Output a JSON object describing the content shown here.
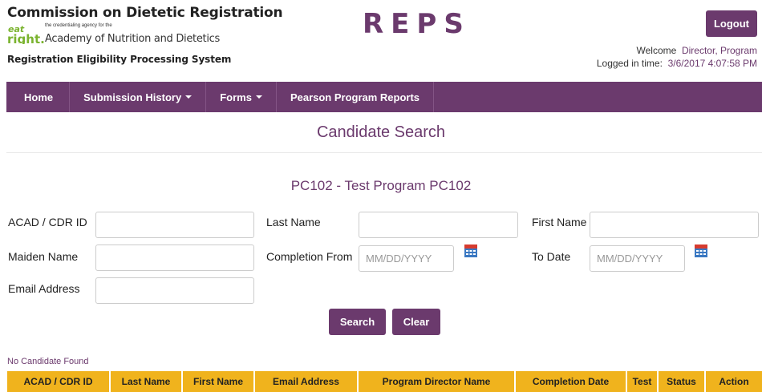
{
  "header": {
    "org_title": "Commission on Dietetic Registration",
    "eatright_logo": "eat right.",
    "tagline": "the credentialing agency for the",
    "academy": "Academy of Nutrition and Dietetics",
    "system_name": "Registration Eligibility Processing System",
    "app_logo": "REPS",
    "logout_label": "Logout",
    "welcome_prefix": "Welcome",
    "user_name": "Director, Program",
    "logged_in_label": "Logged in time:",
    "logged_in_time": "3/6/2017 4:07:58 PM"
  },
  "nav": {
    "items": [
      {
        "label": "Home"
      },
      {
        "label": "Submission History"
      },
      {
        "label": "Forms"
      },
      {
        "label": "Pearson Program Reports"
      }
    ]
  },
  "main": {
    "page_title": "Candidate Search",
    "program_title": "PC102 - Test Program PC102",
    "fields": {
      "acad_cdr_id": {
        "label": "ACAD / CDR ID",
        "value": ""
      },
      "last_name": {
        "label": "Last Name",
        "value": ""
      },
      "first_name": {
        "label": "First Name",
        "value": ""
      },
      "maiden_name": {
        "label": "Maiden Name",
        "value": ""
      },
      "completion_from": {
        "label": "Completion From",
        "placeholder": "MM/DD/YYYY",
        "value": ""
      },
      "to_date": {
        "label": "To Date",
        "placeholder": "MM/DD/YYYY",
        "value": ""
      },
      "email": {
        "label": "Email Address",
        "value": ""
      }
    },
    "search_label": "Search",
    "clear_label": "Clear",
    "result_message": "No Candidate Found"
  },
  "table": {
    "columns": [
      "ACAD / CDR ID",
      "Last Name",
      "First Name",
      "Email Address",
      "Program Director Name",
      "Completion Date",
      "Test",
      "Status",
      "Action"
    ]
  },
  "colors": {
    "brand": "#6b3a6d",
    "header_row": "#f0b31d",
    "eatright_green": "#7ab32e"
  },
  "icons": [
    "calendar-icon",
    "caret-down-icon"
  ]
}
